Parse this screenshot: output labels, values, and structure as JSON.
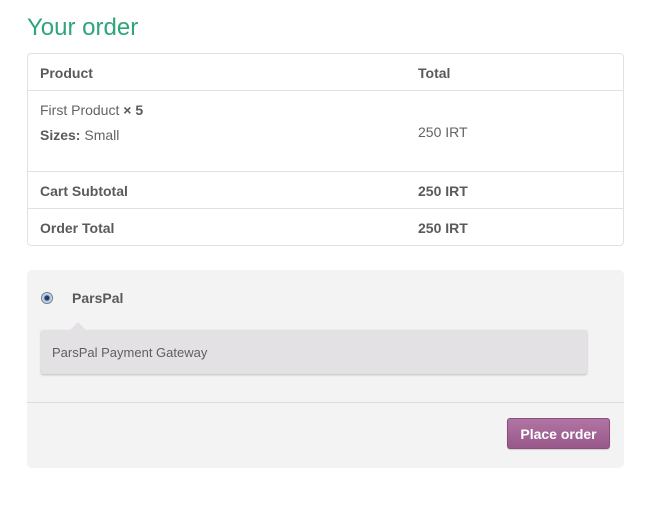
{
  "heading": "Your order",
  "table": {
    "col_product": "Product",
    "col_total": "Total",
    "item": {
      "name": "First Product",
      "qty": "× 5",
      "size_label": "Sizes:",
      "size_value": "Small",
      "total": "250 IRT"
    },
    "subtotal_label": "Cart Subtotal",
    "subtotal_value": "250 IRT",
    "order_total_label": "Order Total",
    "order_total_value": "250 IRT"
  },
  "payment": {
    "method_label": "ParsPal",
    "method_selected": true,
    "method_description": "ParsPal Payment Gateway",
    "place_order_label": "Place order"
  },
  "colors": {
    "heading": "#2fa57a",
    "button": "#a0659a",
    "panel": "#f4f3f4"
  }
}
